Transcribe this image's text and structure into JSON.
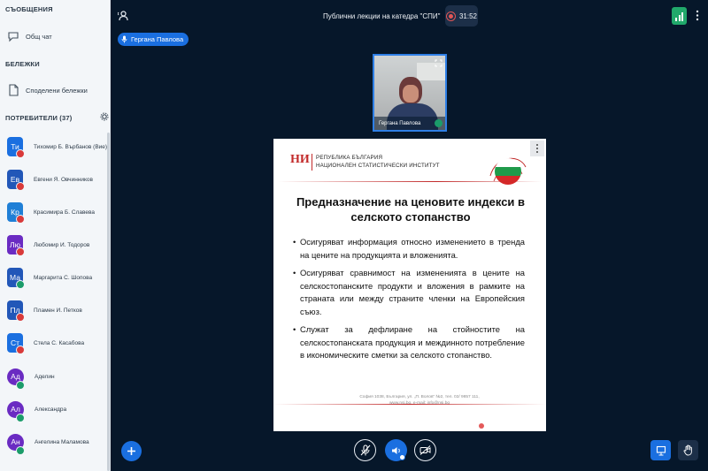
{
  "sidebar": {
    "messages_title": "СЪОБЩЕНИЯ",
    "public_chat": "Общ чат",
    "notes_title": "БЕЛЕЖКИ",
    "shared_notes": "Споделени бележки",
    "users_title": "ПОТРЕБИТЕЛИ (37)",
    "users": [
      {
        "initials": "Ти",
        "name": "Тихомир Б. Върбанов (Вие)",
        "color": "#1a6fe0",
        "mic": "muted"
      },
      {
        "initials": "Ев",
        "name": "Евгени Я. Овчинников",
        "color": "#2257b8",
        "mic": "muted"
      },
      {
        "initials": "Кр",
        "name": "Красимира Б. Славева",
        "color": "#1f7fd6",
        "mic": "muted"
      },
      {
        "initials": "Лю",
        "name": "Любомир И. Тодоров",
        "color": "#6a2bc2",
        "mic": "muted"
      },
      {
        "initials": "Ма",
        "name": "Маргарита С. Шопова",
        "color": "#2257b8",
        "mic": "on"
      },
      {
        "initials": "Пл",
        "name": "Пламен И. Петков",
        "color": "#2257b8",
        "mic": "muted"
      },
      {
        "initials": "Ст",
        "name": "Стела С. Касабова",
        "color": "#1a6fe0",
        "mic": "muted"
      },
      {
        "initials": "Ад",
        "name": "Аделин",
        "color": "#6a2bc2",
        "mic": "on"
      },
      {
        "initials": "Ал",
        "name": "Александра",
        "color": "#6a2bc2",
        "mic": "on"
      },
      {
        "initials": "Ан",
        "name": "Ангелина Маламова",
        "color": "#6a2bc2",
        "mic": "on"
      }
    ]
  },
  "header": {
    "meeting_title": "Публични лекции на катедра \"СПИ\"",
    "timer": "31:52"
  },
  "presenter": {
    "pill_name": "Гергана Павлова",
    "webcam_label": "Гергана Павлова"
  },
  "slide": {
    "logo_text": "НИ",
    "org_line1": "РЕПУБЛИКА БЪЛГАРИЯ",
    "org_line2": "НАЦИОНАЛЕН СТАТИСТИЧЕСКИ ИНСТИТУТ",
    "title": "Предназначение на ценовите индекси в селското стопанство",
    "bullets": [
      "Осигуряват информация относно изменението в тренда на цените на продукцията и вложенията.",
      "Осигуряват сравнимост на измененията в цените на селскостопанските продукти и вложения в рамките на страната или между страните членки на Европейския съюз.",
      "Служат за дефлиране на стойностите на селскостопанската продукция и междинното потребление в икономическите сметки за селското стопанство."
    ],
    "address_line1": "София 1038, България, ул. „П. Волов“ №2, тел. 02/ 9857 111,",
    "address_line2": "www.nsi.bg, e-mail: info@nsi.bg"
  },
  "colors": {
    "accent": "#1a6fe0",
    "background": "#06172a",
    "muted": "#d93a3a",
    "unmuted": "#1b9c6a"
  }
}
